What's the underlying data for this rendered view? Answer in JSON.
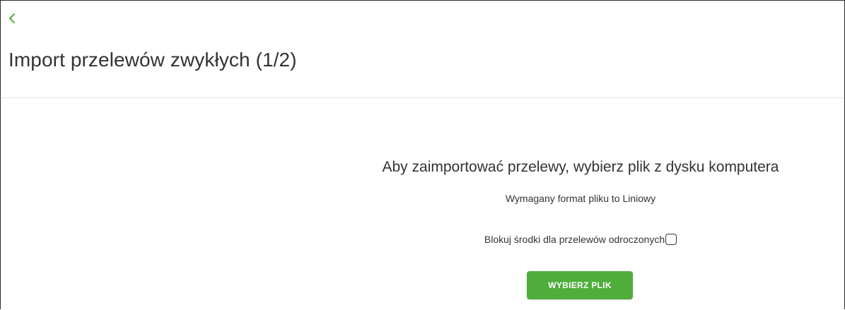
{
  "colors": {
    "accent": "#4fad3b",
    "text": "#333333",
    "divider": "#e2e2e2"
  },
  "header": {
    "back_icon": "chevron-left-icon",
    "title": "Import przelewów zwykłych (1/2)"
  },
  "main": {
    "heading": "Aby zaimportować przelewy, wybierz plik z dysku komputera",
    "format_note": "Wymagany format pliku to Liniowy",
    "block_funds_label": "Blokuj środki dla przelewów odroczonych",
    "block_funds_checked": false,
    "choose_file_label": "WYBIERZ PLIK"
  }
}
